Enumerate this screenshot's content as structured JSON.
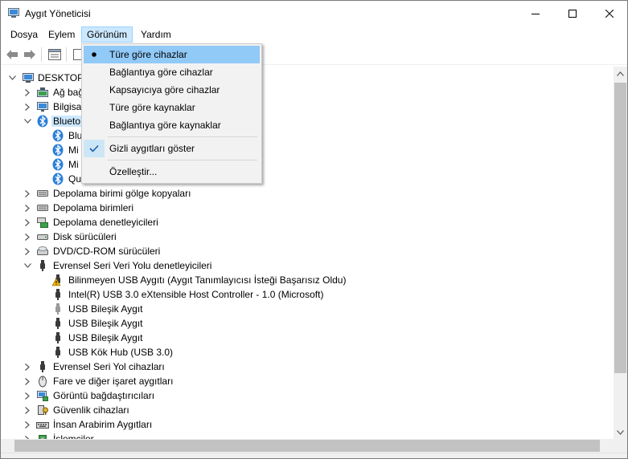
{
  "window": {
    "title": "Aygıt Yöneticisi",
    "controls": {
      "minimize": "minimize",
      "maximize": "maximize",
      "close": "close"
    }
  },
  "menubar": {
    "items": [
      {
        "label": "Dosya"
      },
      {
        "label": "Eylem"
      },
      {
        "label": "Görünüm",
        "active": true
      },
      {
        "label": "Yardım"
      }
    ]
  },
  "toolbar": {
    "icons": [
      "back-arrow-icon",
      "forward-arrow-icon",
      "properties-icon",
      "help-icon"
    ]
  },
  "tree": {
    "root": "DESKTOP-",
    "rows": [
      {
        "label": "DESKTOP-",
        "level": 0,
        "expanded": true,
        "icon": "computer"
      },
      {
        "label": "Ağ bağ",
        "level": 1,
        "expanded": false,
        "icon": "network"
      },
      {
        "label": "Bilgisa",
        "level": 1,
        "expanded": false,
        "icon": "monitor"
      },
      {
        "label": "Blueto",
        "level": 1,
        "expanded": true,
        "icon": "bluetooth",
        "selected": true
      },
      {
        "label": "Blu",
        "level": 2,
        "icon": "bluetooth"
      },
      {
        "label": "Mi",
        "level": 2,
        "icon": "bluetooth"
      },
      {
        "label": "Mi",
        "level": 2,
        "icon": "bluetooth"
      },
      {
        "label": "Qu",
        "level": 2,
        "icon": "bluetooth"
      },
      {
        "label": "Depolama birimi gölge kopyaları",
        "level": 1,
        "expanded": false,
        "icon": "storage"
      },
      {
        "label": "Depolama birimleri",
        "level": 1,
        "expanded": false,
        "icon": "storage"
      },
      {
        "label": "Depolama denetleyicileri",
        "level": 1,
        "expanded": false,
        "icon": "storage-controller"
      },
      {
        "label": "Disk sürücüleri",
        "level": 1,
        "expanded": false,
        "icon": "disk"
      },
      {
        "label": "DVD/CD-ROM sürücüleri",
        "level": 1,
        "expanded": false,
        "icon": "dvd"
      },
      {
        "label": "Evrensel Seri Veri Yolu denetleyicileri",
        "level": 1,
        "expanded": true,
        "icon": "usb"
      },
      {
        "label": "Bilinmeyen USB Aygıtı (Aygıt Tanımlayıcısı İsteği Başarısız Oldu)",
        "level": 2,
        "icon": "warning"
      },
      {
        "label": "Intel(R) USB 3.0 eXtensible Host Controller - 1.0 (Microsoft)",
        "level": 2,
        "icon": "usb"
      },
      {
        "label": "USB Bileşik Aygıt",
        "level": 2,
        "icon": "usb-gray"
      },
      {
        "label": "USB Bileşik Aygıt",
        "level": 2,
        "icon": "usb"
      },
      {
        "label": "USB Bileşik Aygıt",
        "level": 2,
        "icon": "usb"
      },
      {
        "label": "USB Kök Hub (USB 3.0)",
        "level": 2,
        "icon": "usb"
      },
      {
        "label": "Evrensel Seri Yol cihazları",
        "level": 1,
        "expanded": false,
        "icon": "usb"
      },
      {
        "label": "Fare ve diğer işaret aygıtları",
        "level": 1,
        "expanded": false,
        "icon": "mouse"
      },
      {
        "label": "Görüntü bağdaştırıcıları",
        "level": 1,
        "expanded": false,
        "icon": "display-adapter"
      },
      {
        "label": "Güvenlik cihazları",
        "level": 1,
        "expanded": false,
        "icon": "security"
      },
      {
        "label": "İnsan Arabirim Aygıtları",
        "level": 1,
        "expanded": false,
        "icon": "hid"
      },
      {
        "label": "İşlemciler",
        "level": 1,
        "expanded": false,
        "icon": "processor"
      }
    ]
  },
  "view_menu": {
    "items": [
      {
        "label": "Türe göre cihazlar",
        "mark": "bullet"
      },
      {
        "label": "Bağlantıya göre cihazlar",
        "mark": ""
      },
      {
        "label": "Kapsayıcıya göre cihazlar",
        "mark": ""
      },
      {
        "label": "Türe göre kaynaklar",
        "mark": ""
      },
      {
        "label": "Bağlantıya göre kaynaklar",
        "mark": ""
      },
      {
        "label": "Gizli aygıtları göster",
        "mark": "check"
      },
      {
        "label": "Özelleştir...",
        "mark": ""
      }
    ]
  },
  "colors": {
    "menu_hover": "#91c9f7",
    "selection": "#cce8ff",
    "bluetooth": "#2b7fd9",
    "warning": "#f2b600"
  }
}
